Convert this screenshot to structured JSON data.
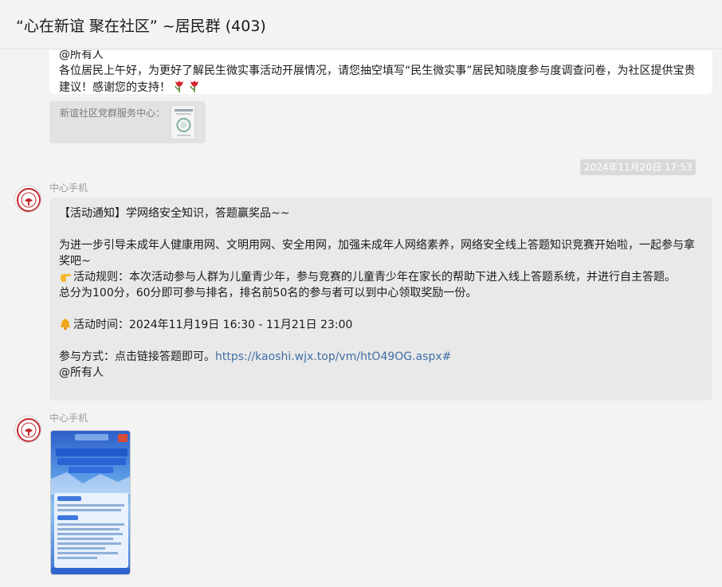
{
  "header": {
    "title": "“心在新谊 聚在社区” ~居民群 (403)"
  },
  "messages": [
    {
      "partial_top": "@所有人",
      "text": "各位居民上午好，为更好了解民生微实事活动开展情况，请您抽空填写“民生微实事”居民知晓度参与度调查问卷，为社区提供宝贵建议！感谢您的支持！",
      "emoji": [
        "tulip",
        "tulip"
      ]
    },
    {
      "quote_label": "新谊社区党群服务中心："
    }
  ],
  "timestamp": "2024年11月20日 17:53",
  "notice": {
    "sender": "中心手机",
    "line1": "【活动通知】学网络安全知识，答题赢奖品~~",
    "line2": "为进一步引导未成年人健康用网、文明用网、安全用网，加强未成年人网络素养，网络安全线上答题知识竞赛开始啦，一起参与拿奖吧~",
    "rules": "活动规则：本次活动参与人群为儿童青少年，参与竞赛的儿童青少年在家长的帮助下进入线上答题系统，并进行自主答题。",
    "score": "总分为100分，60分即可参与排名，排名前50名的参与者可以到中心领取奖励一份。",
    "time": "活动时间：2024年11月19日 16:30 - 11月21日 23:00",
    "method": "参与方式：点击链接答题即可。",
    "link": "https://kaoshi.wjx.top/vm/htO49OG.aspx#",
    "mention": "@所有人"
  },
  "image_message": {
    "sender": "中心手机"
  },
  "colors": {
    "link": "#3f6fa5",
    "bubble": "#e9e9e9",
    "badge": "#d9d9d9"
  },
  "icons": [
    "hand-point-icon",
    "bell-icon",
    "tulip-icon",
    "avatar-logo-icon"
  ]
}
